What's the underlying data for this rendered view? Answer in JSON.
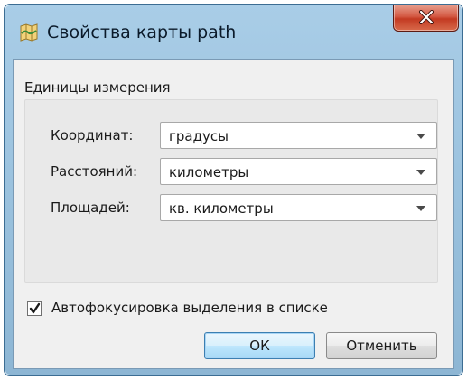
{
  "window": {
    "title": "Свойства карты path",
    "icon": "map-app-icon",
    "close_icon": "close-icon"
  },
  "units_group": {
    "title": "Единицы измерения",
    "rows": [
      {
        "label": "Координат:",
        "value": "градусы"
      },
      {
        "label": "Расстояний:",
        "value": "километры"
      },
      {
        "label": "Площадей:",
        "value": "кв. километры"
      }
    ]
  },
  "autofocus": {
    "label": "Автофокусировка выделения в списке",
    "checked": true
  },
  "buttons": {
    "ok": "ОК",
    "cancel": "Отменить"
  },
  "colors": {
    "title_bar": "#9cc3df",
    "close_button": "#c33a22",
    "client_background": "#f0f0f0",
    "default_button_border": "#3c7fb1"
  }
}
